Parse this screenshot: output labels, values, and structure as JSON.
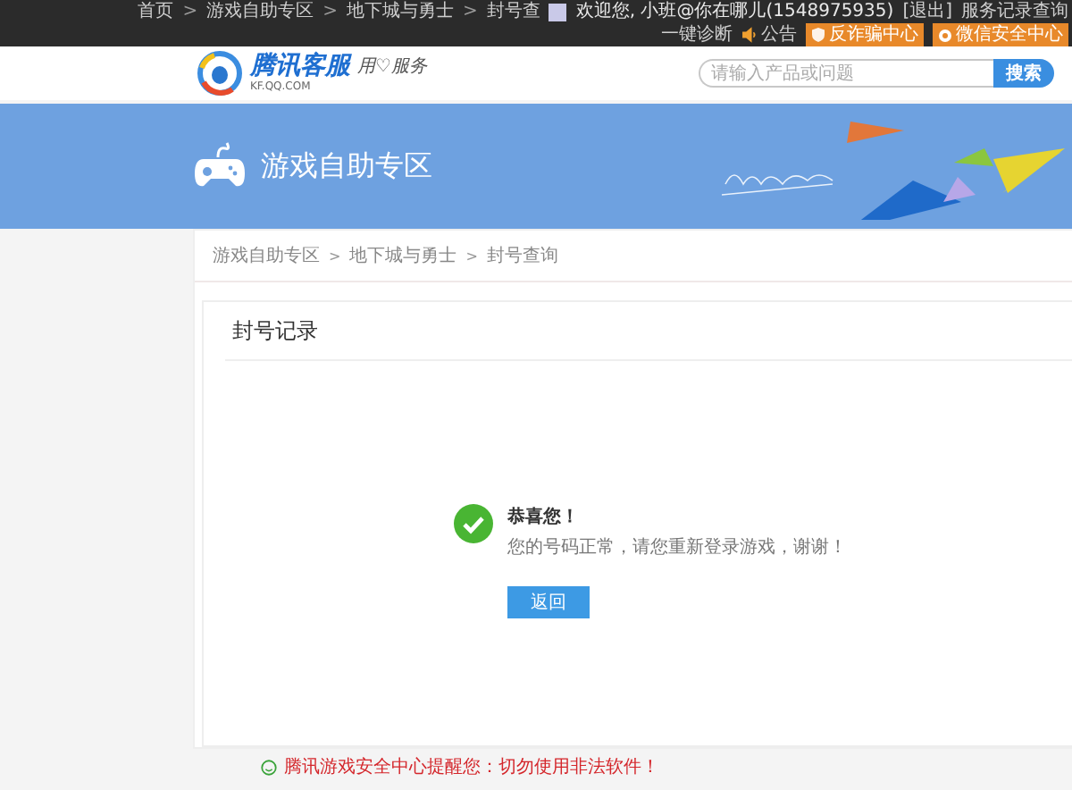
{
  "top_bar": {
    "breadcrumb": [
      {
        "label": "首页"
      },
      {
        "label": "游戏自助专区"
      },
      {
        "label": "地下城与勇士"
      },
      {
        "label": "封号查"
      }
    ],
    "separator": ">",
    "welcome": "欢迎您, 小班@你在哪儿(1548975935)",
    "logout": "[退出]",
    "links": [
      {
        "label": "服务记录查询",
        "kind": "plain"
      },
      {
        "label": "一键诊断",
        "kind": "plain"
      },
      {
        "label": "公告",
        "kind": "speaker"
      },
      {
        "label": "反诈骗中心",
        "kind": "shield"
      },
      {
        "label": "微信安全中心",
        "kind": "badge"
      }
    ]
  },
  "header": {
    "logo_title": "腾讯客服",
    "logo_domain": "KF.QQ.COM",
    "slogan": "用♡服务",
    "search": {
      "placeholder": "请输入产品或问题",
      "button": "搜索"
    }
  },
  "banner": {
    "title": "游戏自助专区"
  },
  "breadcrumb": [
    {
      "label": "游戏自助专区"
    },
    {
      "label": "地下城与勇士"
    },
    {
      "label": "封号查询"
    }
  ],
  "breadcrumb_separator": ">",
  "card": {
    "title": "封号记录",
    "result": {
      "kind": "success",
      "heading": "恭喜您！",
      "message": "您的号码正常，请您重新登录游戏，谢谢！",
      "button": "返回"
    }
  },
  "footer_notice": "腾讯游戏安全中心提醒您：切勿使用非法软件！"
}
